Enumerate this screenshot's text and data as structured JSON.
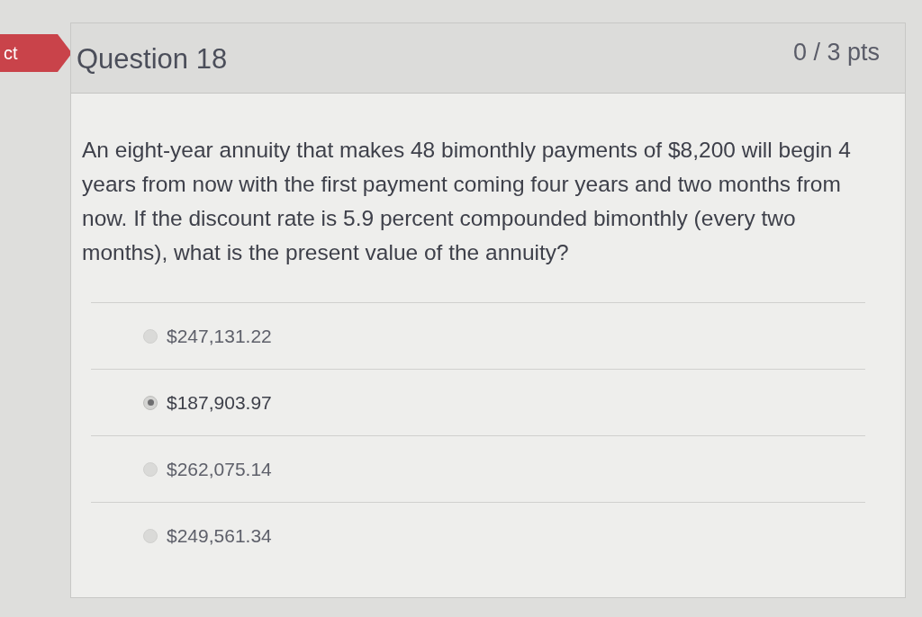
{
  "banner": {
    "text": "ct"
  },
  "question": {
    "title": "Question 18",
    "points": "0 / 3 pts",
    "text": "An eight-year annuity that makes 48 bimonthly payments of $8,200 will begin 4 years from now with the first payment coming four years and two months from now. If the discount rate is 5.9 percent compounded bimonthly (every two months), what is the present value of the annuity?"
  },
  "answers": [
    {
      "label": "$247,131.22",
      "selected": false
    },
    {
      "label": "$187,903.97",
      "selected": true
    },
    {
      "label": "$262,075.14",
      "selected": false
    },
    {
      "label": "$249,561.34",
      "selected": false
    }
  ]
}
